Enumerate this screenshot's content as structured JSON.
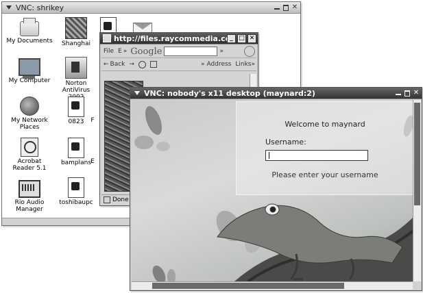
{
  "windows": {
    "shrikey": {
      "title": "VNC: shrikey",
      "icons": [
        {
          "label": "My Documents",
          "icon": "folder-icon"
        },
        {
          "label": "Shanghai",
          "icon": "photo-icon"
        },
        {
          "label": "My Computer",
          "icon": "computer-icon"
        },
        {
          "label": "Norton AntiVirus 2002",
          "icon": "antivirus-icon"
        },
        {
          "label": "My Network Places",
          "icon": "network-icon"
        },
        {
          "label": "0823",
          "icon": "image-file-icon"
        },
        {
          "label": "F",
          "icon": "truncated-label"
        },
        {
          "label": "Acrobat Reader 5.1",
          "icon": "acrobat-icon"
        },
        {
          "label": "bamplans",
          "icon": "image-file-icon"
        },
        {
          "label": "E",
          "icon": "truncated-label"
        },
        {
          "label": "Rio Audio Manager",
          "icon": "audio-icon"
        },
        {
          "label": "toshibaupc",
          "icon": "image-file-icon"
        }
      ]
    },
    "browser": {
      "title": "http://files.raycommedia.com",
      "menu_file": "File",
      "menu_e": "E",
      "chev1": "»",
      "google": "Google",
      "chev2": "»",
      "back": "Back",
      "forward": "→",
      "chev3": "»",
      "address": "Address",
      "links": "Links",
      "chev4": "»",
      "status": "Done"
    },
    "vnc": {
      "title": "VNC: nobody's x11 desktop (maynard:2)",
      "welcome": "Welcome to maynard",
      "username_label": "Username:",
      "username_value": "",
      "hint": "Please enter your username"
    }
  }
}
